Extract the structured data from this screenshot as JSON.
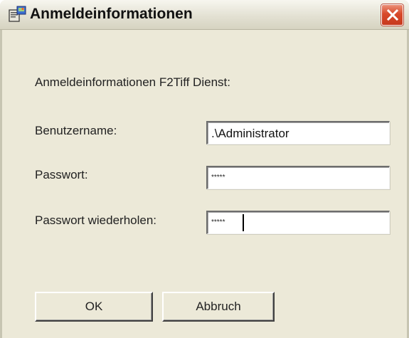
{
  "window": {
    "title": "Anmeldeinformationen",
    "heading": "Anmeldeinformationen F2Tiff Dienst:",
    "app_icon": "app-icon",
    "close_icon": "close-icon"
  },
  "form": {
    "username": {
      "label": "Benutzername:",
      "value": ".\\Administrator"
    },
    "password": {
      "label": "Passwort:",
      "value": "*****"
    },
    "password_repeat": {
      "label": "Passwort wiederholen:",
      "value": "*****"
    }
  },
  "buttons": {
    "ok": "OK",
    "cancel": "Abbruch"
  },
  "colors": {
    "dialog_background": "#ece9d8",
    "close_button": "#d8492a"
  }
}
